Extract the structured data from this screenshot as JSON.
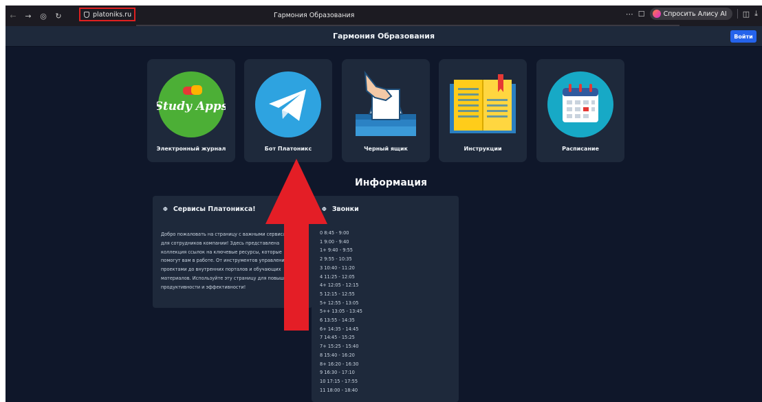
{
  "browser": {
    "url": "platoniks.ru",
    "tab_title": "Гармония Образования",
    "alice_label": "Спросить Алису AI"
  },
  "header": {
    "title": "Гармония Образования",
    "login_label": "Войти"
  },
  "cards": [
    {
      "label": "Электронный журнал",
      "logo_text": "Study Apps",
      "icon": "study-apps-icon"
    },
    {
      "label": "Бот Платоникс",
      "icon": "telegram-icon"
    },
    {
      "label": "Черный ящик",
      "icon": "ballot-box-icon"
    },
    {
      "label": "Инструкции",
      "icon": "book-icon"
    },
    {
      "label": "Расписание",
      "icon": "calendar-icon"
    }
  ],
  "info": {
    "title": "Информация",
    "services": {
      "title": "Сервисы Платоникса!",
      "text": "Добро пожаловать на страницу с важными сервисами для сотрудников компании! Здесь представлена коллекция ссылок на ключевые ресурсы, которые помогут вам в работе. От инструментов управления проектами до внутренних порталов и обучающих материалов. Используйте эту страницу для повышения продуктивности и эффективности!"
    },
    "bells": {
      "title": "Звонки",
      "items": [
        "0 8:45 - 9:00",
        "1 9:00 - 9:40",
        "1+ 9:40 - 9:55",
        "2 9:55 - 10:35",
        "3 10:40 - 11:20",
        "4 11:25 - 12:05",
        "4+ 12:05 - 12:15",
        "5 12:15 - 12:55",
        "5+ 12:55 - 13:05",
        "5++ 13:05 - 13:45",
        "6 13:55 - 14:35",
        "6+ 14:35 - 14:45",
        "7 14:45 - 15:25",
        "7+ 15:25 - 15:40",
        "8 15:40 - 16:20",
        "8+ 16:20 - 16:30",
        "9 16:30 - 17:10",
        "10 17:15 - 17:55",
        "11 18:00 - 18:40"
      ]
    }
  },
  "colors": {
    "background": "#0f172a",
    "card": "#1e293b",
    "accent": "#2563eb",
    "arrow": "#e41e26",
    "highlight_box": "#e02020"
  }
}
